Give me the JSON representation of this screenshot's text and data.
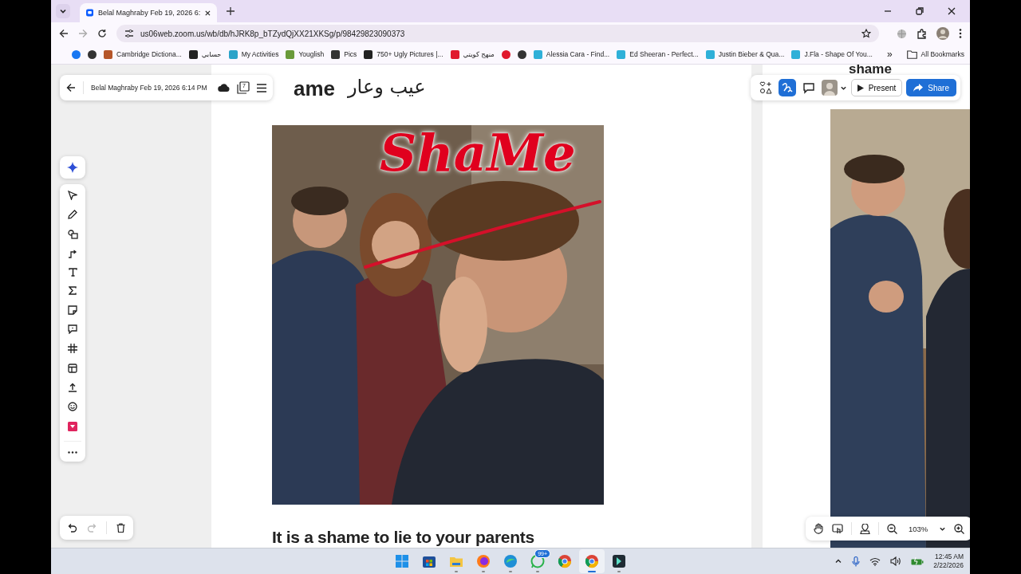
{
  "browser": {
    "tab": {
      "title": "Belal Maghraby Feb 19, 2026 6:",
      "selected": true
    },
    "url": "us06web.zoom.us/wb/db/hJRK8p_bTZydQjXX21XKSg/p/98429823090373",
    "bookmarks": [
      {
        "color": "#1877f2"
      },
      {
        "color": "#333333"
      },
      {
        "label": "Cambridge Dictiona...",
        "color": "#b5562a"
      },
      {
        "label": "حسابي",
        "color": "#222222"
      },
      {
        "label": "My Activities",
        "color": "#2aa3c9"
      },
      {
        "label": "Youglish",
        "color": "#6a9a3a"
      },
      {
        "label": "Pics",
        "color": "#333333"
      },
      {
        "label": "750+ Ugly Pictures |...",
        "color": "#222222"
      },
      {
        "label": "منهج كويتي",
        "color": "#e0192d"
      },
      {
        "color": "#e0192d"
      },
      {
        "color": "#333333"
      },
      {
        "label": "Alessia Cara - Find...",
        "color": "#2fb0d8"
      },
      {
        "label": "Ed Sheeran - Perfect...",
        "color": "#2fb0d8"
      },
      {
        "label": "Justin Bieber & Qua...",
        "color": "#2fb0d8"
      },
      {
        "label": "J.Fla - Shape Of You...",
        "color": "#2fb0d8"
      }
    ],
    "more": "»",
    "all_bookmarks": "All Bookmarks"
  },
  "board": {
    "title": "Belal Maghraby Feb 19, 2026 6:14 PM",
    "page_count": "7",
    "heading": "ame",
    "heading_arabic": "عيب وعار",
    "ink_text": "ShaMe",
    "caption": "It is a shame to lie to your parents",
    "right_heading": "shame",
    "top_tools": [
      {
        "selected": false
      },
      {
        "selected": true
      },
      {
        "selected": false
      }
    ],
    "present": "Present",
    "share": "Share",
    "undo": {
      "disabled": false
    },
    "redo": {
      "disabled": true
    },
    "zoom": "103%"
  },
  "taskbar": {
    "apps": [
      {
        "selected": false,
        "running": false
      },
      {
        "selected": false,
        "running": false
      },
      {
        "selected": false,
        "running": true
      },
      {
        "selected": false,
        "running": true
      },
      {
        "selected": false,
        "running": true
      },
      {
        "selected": false,
        "running": true,
        "badge": "99+"
      },
      {
        "selected": false,
        "running": false
      },
      {
        "selected": true,
        "running": true
      },
      {
        "selected": false,
        "running": true
      }
    ],
    "time": "12:45 AM",
    "date": "2/22/2026"
  }
}
